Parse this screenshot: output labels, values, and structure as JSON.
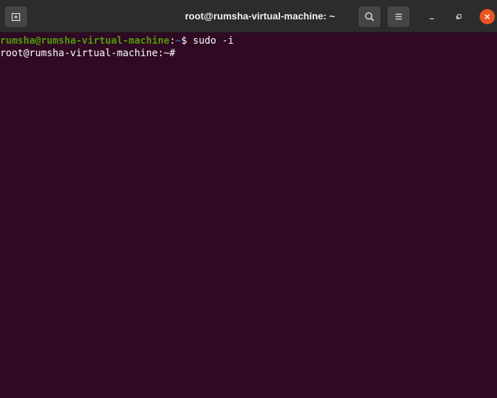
{
  "window": {
    "title": "root@rumsha-virtual-machine: ~"
  },
  "icons": {
    "new_tab": "new-tab-icon",
    "search": "search-icon",
    "menu": "hamburger-menu-icon",
    "minimize": "minimize-icon",
    "maximize": "maximize-icon",
    "close": "close-icon"
  },
  "colors": {
    "terminal_bg": "#300a24",
    "titlebar_bg": "#2c2c2c",
    "prompt_user": "#4e9a06",
    "prompt_path": "#3465a4",
    "close_button": "#e95420"
  },
  "terminal": {
    "lines": [
      {
        "user_host": "rumsha@rumsha-virtual-machine",
        "colon": ":",
        "path": "~",
        "prompt_symbol": "$ ",
        "command": "sudo -i"
      },
      {
        "root_prompt": "root@rumsha-virtual-machine:~#"
      }
    ]
  }
}
